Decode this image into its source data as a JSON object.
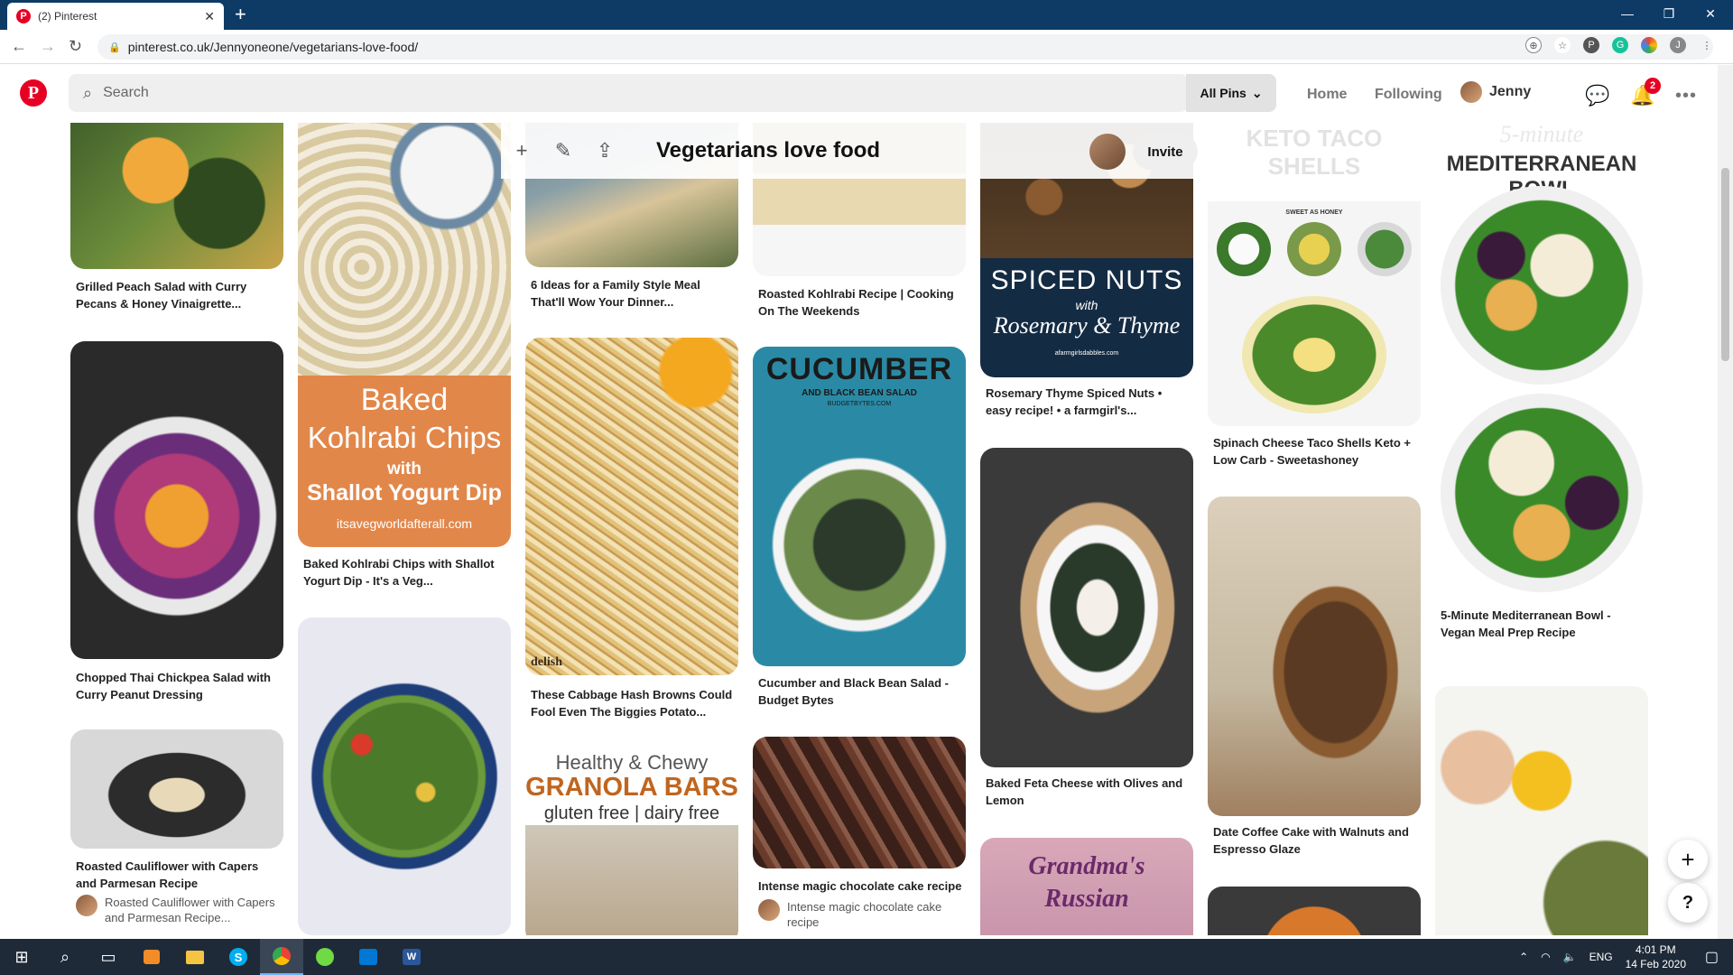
{
  "browser": {
    "tab_title": "(2) Pinterest",
    "tab_close": "✕",
    "new_tab": "+",
    "url": "pinterest.co.uk/Jennyoneone/vegetarians-love-food/",
    "profile_initial": "J",
    "favicon_letter": "P",
    "window_controls": [
      "—",
      "❐",
      "✕"
    ]
  },
  "header": {
    "logo_letter": "P",
    "search_placeholder": "Search",
    "filter_label": "All Pins",
    "nav_home": "Home",
    "nav_following": "Following",
    "user_name": "Jenny",
    "notification_count": "2"
  },
  "board": {
    "title": "Vegetarians love food",
    "invite_label": "Invite"
  },
  "pins": {
    "c1": [
      {
        "title": "Grilled Peach Salad with Curry Pecans & Honey Vinaigrette..."
      },
      {
        "title": "Chopped Thai Chickpea Salad with Curry Peanut Dressing"
      },
      {
        "title": "Roasted Cauliflower with Capers and Parmesan Recipe",
        "saved": "Roasted Cauliflower with Capers and Parmesan Recipe..."
      }
    ],
    "c2": [
      {
        "title": "Baked Kohlrabi Chips with Shallot Yogurt Dip - It's a Veg...",
        "overlay1": "Baked",
        "overlay2": "Kohlrabi Chips",
        "overlay3": "with",
        "overlay4": "Shallot Yogurt Dip",
        "overlay5": "itsavegworldafterall.com"
      },
      {
        "title": ""
      }
    ],
    "c3": [
      {
        "title": "6 Ideas for a Family Style Meal That'll Wow Your Dinner..."
      },
      {
        "title": "These Cabbage Hash Browns Could Fool Even The Biggies Potato...",
        "overlay1": "delish"
      },
      {
        "title": "",
        "overlay1": "Healthy & Chewy",
        "overlay2": "GRANOLA BARS",
        "overlay3": "gluten free | dairy free"
      }
    ],
    "c4": [
      {
        "title": "Roasted Kohlrabi Recipe | Cooking On The Weekends"
      },
      {
        "title": "Cucumber and Black Bean Salad - Budget Bytes",
        "overlay1": "CUCUMBER",
        "overlay2": "AND BLACK BEAN SALAD",
        "overlay3": "BUDGETBYTES.COM"
      },
      {
        "title": "Intense magic chocolate cake recipe",
        "saved": "Intense magic chocolate cake recipe"
      }
    ],
    "c5": [
      {
        "title": "Rosemary Thyme Spiced Nuts • easy recipe! • a farmgirl's...",
        "overlay1": "SPICED NUTS",
        "overlay2": "with",
        "overlay3": "Rosemary & Thyme",
        "overlay4": "afarmgirlsdabbles.com"
      },
      {
        "title": "Baked Feta Cheese with Olives and Lemon"
      },
      {
        "title": "",
        "overlay1": "Grandma's",
        "overlay2": "Russian"
      }
    ],
    "c6": [
      {
        "title": "Spinach Cheese Taco Shells Keto + Low Carb - Sweetashoney",
        "overlay1": "KETO TACO SHELLS",
        "overlay2": "SWEET AS HONEY"
      },
      {
        "title": "Date Coffee Cake with Walnuts and Espresso Glaze"
      },
      {
        "title": ""
      }
    ],
    "c7": [
      {
        "title": "5-Minute Mediterranean Bowl - Vegan Meal Prep Recipe",
        "overlay1": "5-minute",
        "overlay2": "MEDITERRANEAN BOWL"
      },
      {
        "title": ""
      }
    ]
  },
  "fab": {
    "add": "+",
    "help": "?"
  },
  "taskbar": {
    "lang": "ENG",
    "time": "4:01 PM",
    "date": "14 Feb 2020"
  },
  "colors": {
    "pinterest_red": "#e60023",
    "tabbar": "#0d3b66",
    "taskbar": "#1f2a38"
  }
}
